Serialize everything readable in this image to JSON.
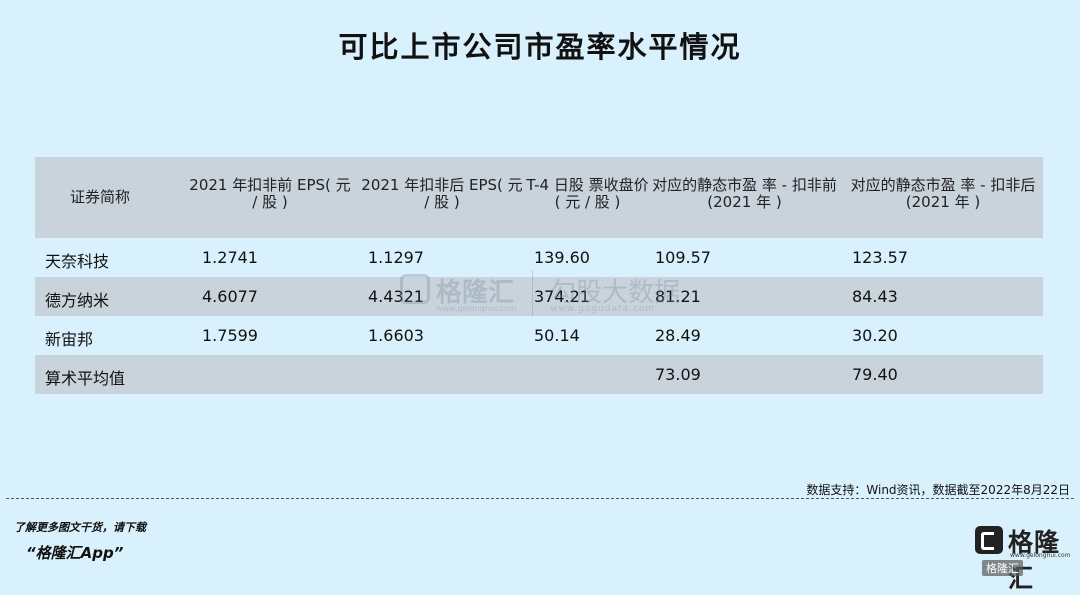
{
  "title": "可比上市公司市盈率水平情况",
  "table": {
    "headers": [
      "证券简称",
      "2021 年扣非前 EPS( 元 / 股 )",
      "2021 年扣非后 EPS( 元 / 股 )",
      "T-4 日股 票收盘价 ( 元 / 股 )",
      "对应的静态市盈 率 - 扣非前 (2021 年 )",
      "对应的静态市盈 率 - 扣非后 (2021 年 )"
    ],
    "rows": [
      [
        "天奈科技",
        "1.2741",
        "1.1297",
        "139.60",
        "109.57",
        "123.57"
      ],
      [
        "德方纳米",
        "4.6077",
        "4.4321",
        "374.21",
        "81.21",
        "84.43"
      ],
      [
        "新宙邦",
        "1.7599",
        "1.6603",
        "50.14",
        "28.49",
        "30.20"
      ],
      [
        "算术平均值",
        "",
        "",
        "",
        "73.09",
        "79.40"
      ]
    ]
  },
  "watermark": {
    "name": "格隆汇",
    "site": "www.gelonghui.com",
    "name2": "勾股大数据",
    "site2": "www.gogudata.com"
  },
  "source": "数据支持：Wind资讯，数据截至2022年8月22日",
  "promo": {
    "line1": "了解更多图文干货，请下载",
    "line2": "“格隆汇App”"
  },
  "brand": {
    "name": "格隆汇",
    "site": "www.gelonghui.com",
    "tag": "格隆汇"
  }
}
